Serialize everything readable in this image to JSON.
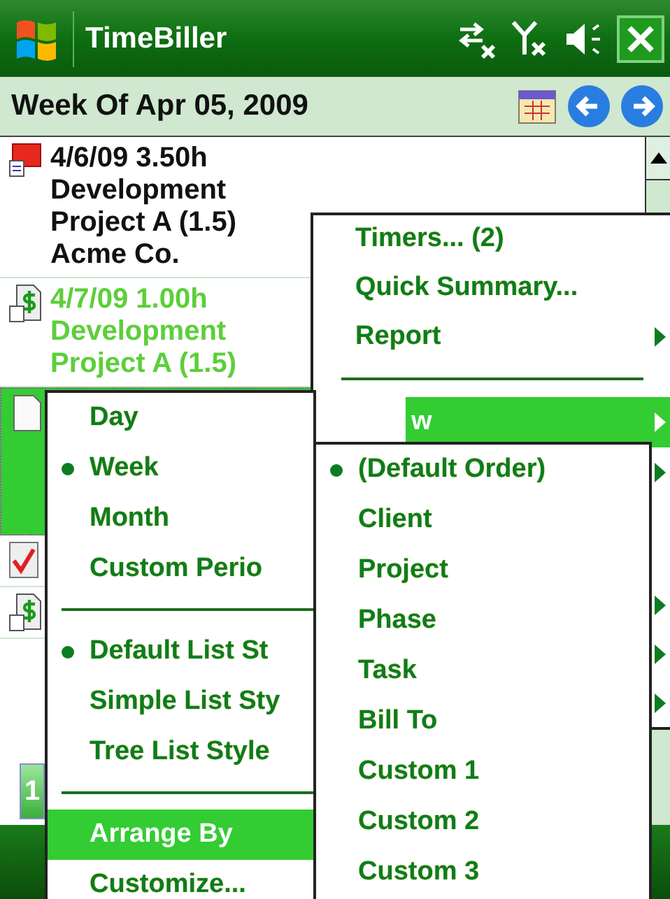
{
  "title_bar": {
    "title": "TimeBiller"
  },
  "header": {
    "title": "Week Of Apr 05, 2009"
  },
  "entries": [
    {
      "kind": "timer",
      "selected": false,
      "lines": [
        "4/6/09 3.50h",
        "Development",
        "Project A (1.5)",
        "Acme Co."
      ]
    },
    {
      "kind": "billed",
      "selected": false,
      "lines": [
        "4/7/09 1.00h",
        "Development",
        "Project A (1.5)"
      ]
    },
    {
      "kind": "note",
      "selected": true
    },
    {
      "kind": "paid",
      "selected": false
    },
    {
      "kind": "billed",
      "selected": false
    }
  ],
  "bottom_button": {
    "label": "1"
  },
  "main_menu": [
    {
      "kind": "item",
      "label": "Timers... (2)",
      "selected": false
    },
    {
      "kind": "item",
      "label": "Quick Summary...",
      "selected": false
    },
    {
      "kind": "submenu",
      "label": "Report",
      "selected": false
    },
    {
      "kind": "separator"
    },
    {
      "kind": "cut_submenu",
      "label": "w",
      "selected": true
    },
    {
      "kind": "covered_submenu"
    },
    {
      "kind": "covered_item"
    },
    {
      "kind": "separator"
    },
    {
      "kind": "covered_submenu"
    },
    {
      "kind": "covered_submenu"
    },
    {
      "kind": "covered_submenu"
    }
  ],
  "view_menu": [
    {
      "kind": "item",
      "label": "Day",
      "checked": false,
      "selected": false
    },
    {
      "kind": "item",
      "label": "Week",
      "checked": true,
      "selected": false
    },
    {
      "kind": "item",
      "label": "Month",
      "checked": false,
      "selected": false
    },
    {
      "kind": "item",
      "label": "Custom Perio",
      "checked": false,
      "selected": false
    },
    {
      "kind": "separator"
    },
    {
      "kind": "item",
      "label": "Default List St",
      "checked": true,
      "selected": false
    },
    {
      "kind": "item",
      "label": "Simple List Sty",
      "checked": false,
      "selected": false
    },
    {
      "kind": "item",
      "label": "Tree List Style",
      "checked": false,
      "selected": false
    },
    {
      "kind": "separator"
    },
    {
      "kind": "item",
      "label": "Arrange By",
      "checked": false,
      "selected": true
    },
    {
      "kind": "item",
      "label": "Customize...",
      "checked": false,
      "selected": false
    }
  ],
  "arrange_menu": [
    {
      "label": "(Default Order)",
      "checked": true,
      "selected": false
    },
    {
      "label": "Client",
      "checked": false,
      "selected": false
    },
    {
      "label": "Project",
      "checked": false,
      "selected": false
    },
    {
      "label": "Phase",
      "checked": false,
      "selected": false
    },
    {
      "label": "Task",
      "checked": false,
      "selected": false
    },
    {
      "label": "Bill To",
      "checked": false,
      "selected": false
    },
    {
      "label": "Custom 1",
      "checked": false,
      "selected": false
    },
    {
      "label": "Custom 2",
      "checked": false,
      "selected": false
    },
    {
      "label": "Custom 3",
      "checked": false,
      "selected": false
    }
  ]
}
